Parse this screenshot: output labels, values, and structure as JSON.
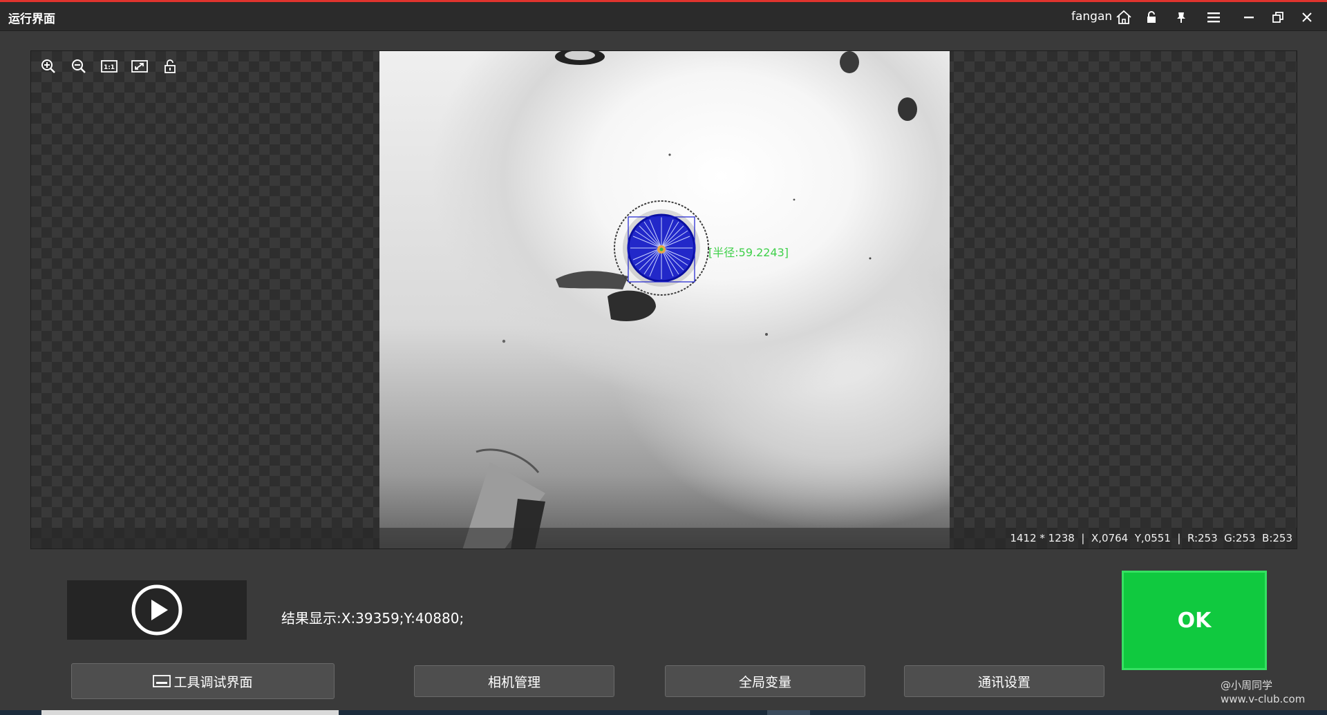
{
  "window": {
    "title": "运行界面",
    "user": "fangan",
    "accent_color": "#e0342e"
  },
  "toolbar_icons": [
    "home-icon",
    "lock-icon",
    "pin-icon",
    "menu-icon",
    "minimize-icon",
    "restore-icon",
    "close-icon"
  ],
  "viewer": {
    "tools": [
      "zoom-in-icon",
      "zoom-out-icon",
      "actual-size-icon",
      "fit-window-icon",
      "unlock-icon"
    ],
    "overlay_label": "[半径:59.2243]",
    "status": {
      "resolution": "1412 * 1238",
      "coords": "X,0764  Y,0551",
      "rgb": "R:253  G:253  B:253"
    }
  },
  "result": {
    "text": "结果显示:X:39359;Y:40880;"
  },
  "ok_badge": {
    "label": "OK",
    "color": "#10c93f"
  },
  "buttons": {
    "tool_debug": "工具调试界面",
    "camera": "相机管理",
    "global_vars": "全局变量",
    "comm_settings": "通讯设置"
  },
  "watermark": {
    "line1": "@小周同学",
    "line2": "www.v-club.com"
  }
}
